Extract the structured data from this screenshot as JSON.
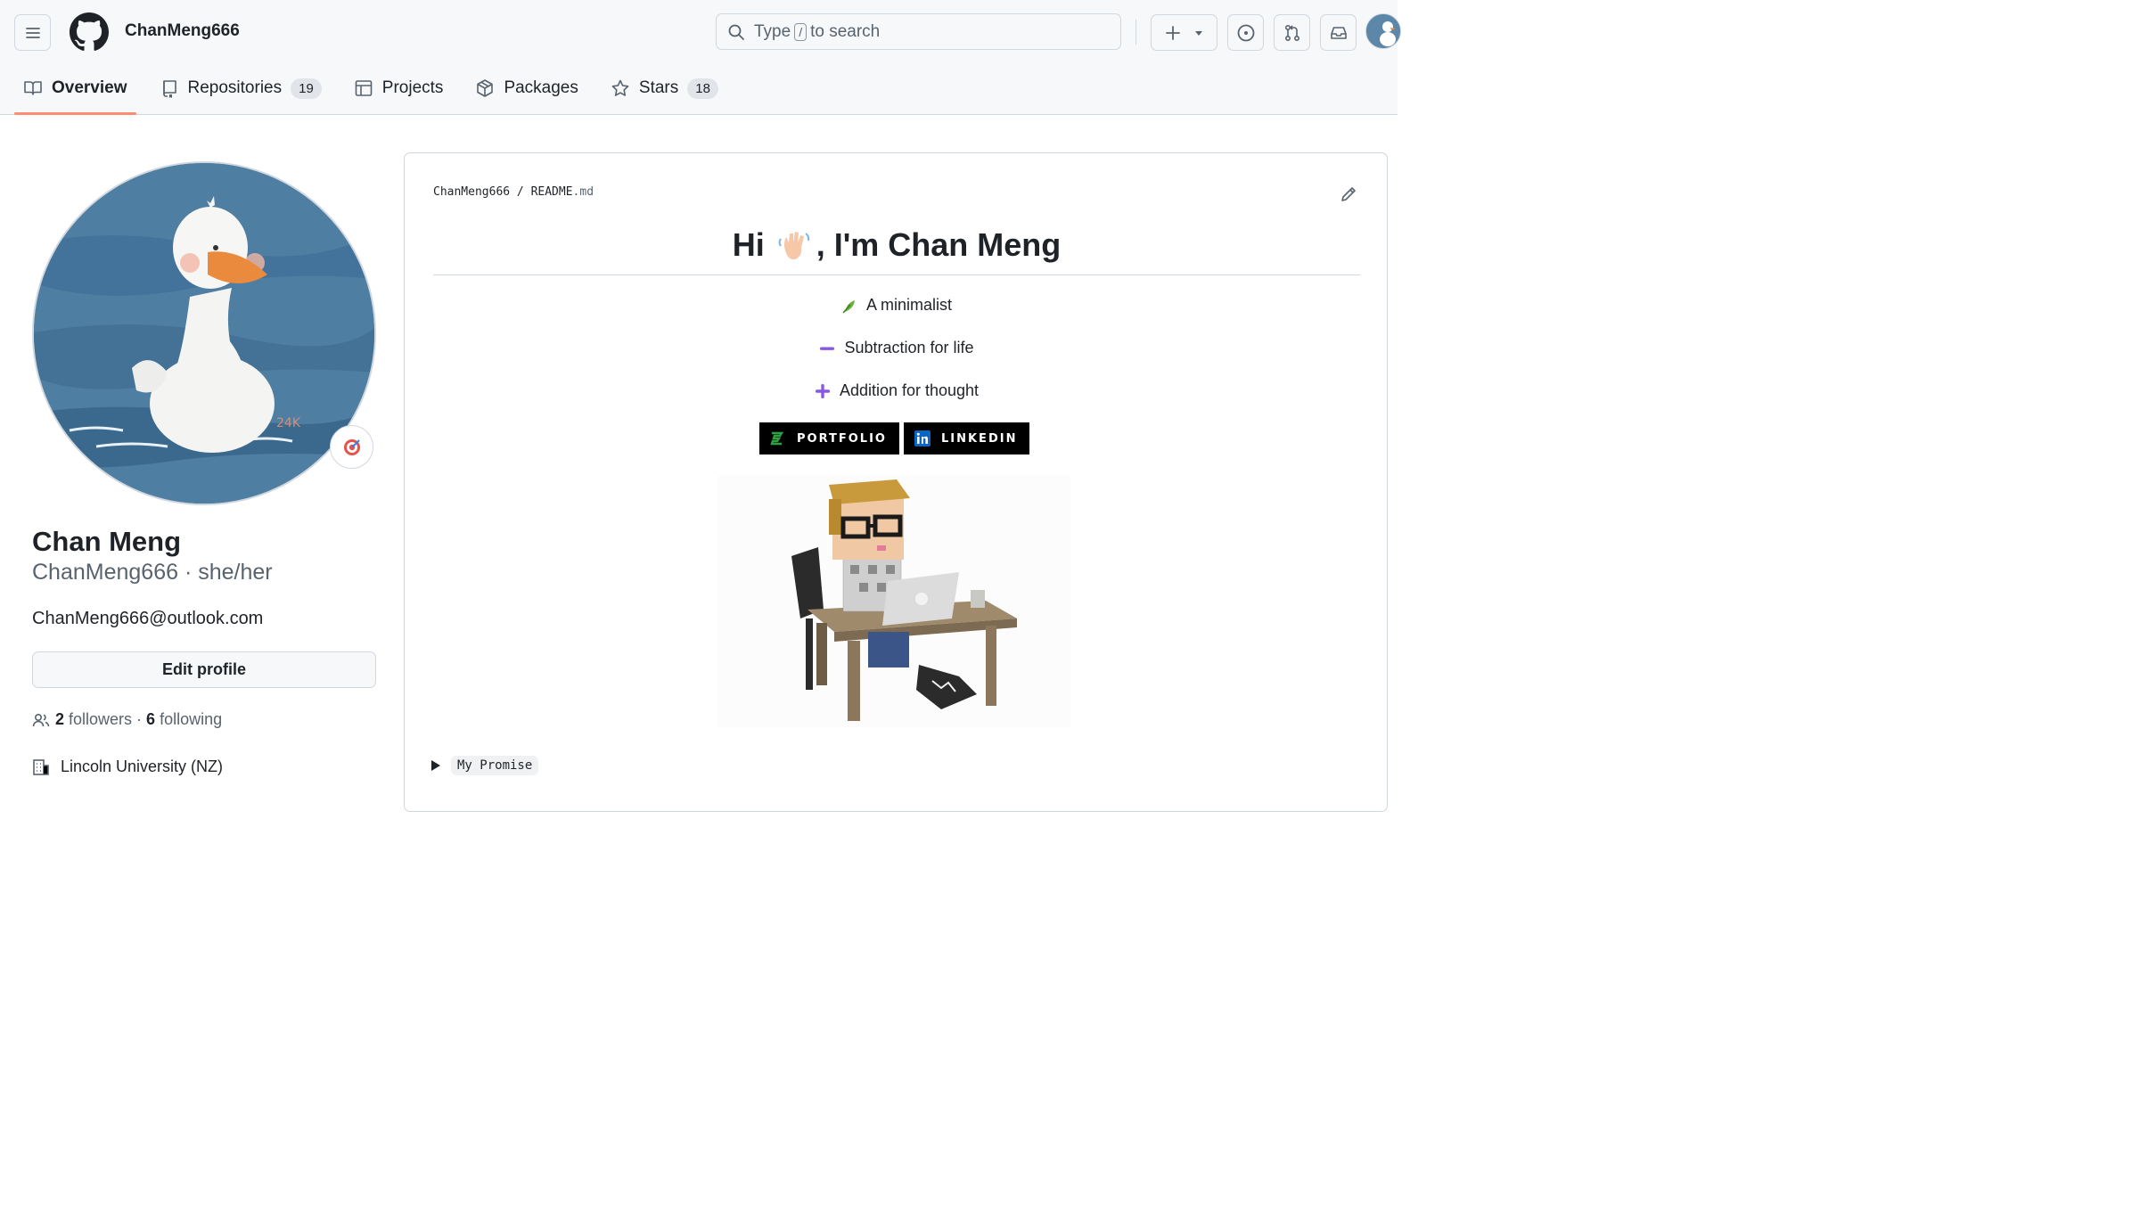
{
  "header": {
    "owner": "ChanMeng666",
    "search": {
      "prefix": "Type",
      "key": "/",
      "suffix": "to search"
    }
  },
  "tabs": [
    {
      "label": "Overview",
      "icon": "book-icon",
      "active": true
    },
    {
      "label": "Repositories",
      "icon": "repo-icon",
      "count": "19"
    },
    {
      "label": "Projects",
      "icon": "table-icon"
    },
    {
      "label": "Packages",
      "icon": "package-icon"
    },
    {
      "label": "Stars",
      "icon": "star-icon",
      "count": "18"
    }
  ],
  "profile": {
    "name": "Chan Meng",
    "login_line": "ChanMeng666 · she/her",
    "email": "ChanMeng666@outlook.com",
    "edit_label": "Edit profile",
    "followers_count": "2",
    "followers_label": "followers",
    "separator": "·",
    "following_count": "6",
    "following_label": "following",
    "organization": "Lincoln University (NZ)",
    "status_icon": "target-emoji-icon"
  },
  "readme": {
    "path_owner": "ChanMeng666",
    "path_sep": "/",
    "path_file": "README",
    "path_ext": ".md",
    "title_pre": "Hi",
    "title_post": ", I'm Chan Meng",
    "lines": [
      {
        "icon": "leaf-emoji-icon",
        "text": "A minimalist"
      },
      {
        "icon": "minus-emoji-icon",
        "text": "Subtraction for life"
      },
      {
        "icon": "plus-emoji-icon",
        "text": "Addition for thought"
      }
    ],
    "badges": [
      {
        "label": "PORTFOLIO",
        "icon": "portfolio-icon",
        "icon_color": "#2ea043"
      },
      {
        "label": "LINKEDIN",
        "icon": "linkedin-icon",
        "icon_color": "#0a66c2"
      }
    ],
    "summary_label": "My Promise"
  },
  "colors": {
    "active_tab_underline": "#fd8c73",
    "emoji_purple": "#8957e5",
    "avatar_background": "#4f7ea3"
  }
}
